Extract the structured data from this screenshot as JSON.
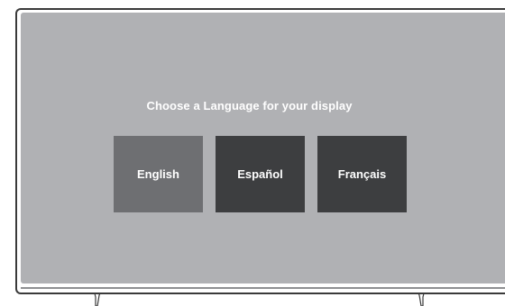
{
  "screen": {
    "prompt": "Choose a Language for your display"
  },
  "languages": [
    {
      "label": "English",
      "selected": true
    },
    {
      "label": "Español",
      "selected": false
    },
    {
      "label": "Français",
      "selected": false
    }
  ],
  "colors": {
    "screen_bg": "#b0b1b4",
    "tile_selected": "#6e6f72",
    "tile_normal": "#3d3e40",
    "text": "#ffffff",
    "frame": "#3a3a3a"
  }
}
